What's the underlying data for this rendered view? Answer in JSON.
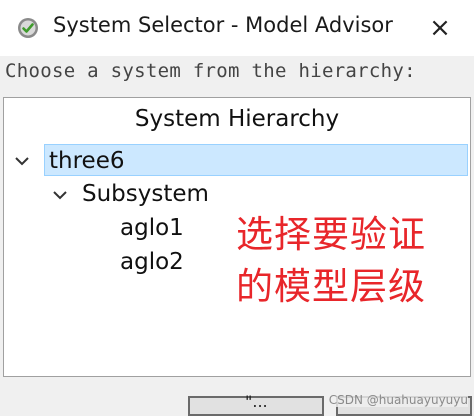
{
  "window": {
    "title": "System Selector - Model Advisor",
    "app_icon": "check-circle-icon",
    "close_glyph": "×"
  },
  "prompt": "Choose a system from the hierarchy:",
  "tree": {
    "header": "System Hierarchy",
    "nodes": [
      {
        "label": "three6",
        "level": 0,
        "expanded": true,
        "selected": true
      },
      {
        "label": "Subsystem",
        "level": 1,
        "expanded": true,
        "selected": false
      },
      {
        "label": "aglo1",
        "level": 2,
        "selected": false
      },
      {
        "label": "aglo2",
        "level": 2,
        "selected": false
      }
    ]
  },
  "annotation": {
    "line1": "选择要验证",
    "line2": "的模型层级",
    "color": "#e8262a"
  },
  "buttons": {
    "ok_partial": "\"..."
  },
  "watermark": "CSDN @huahuayuyuyu"
}
